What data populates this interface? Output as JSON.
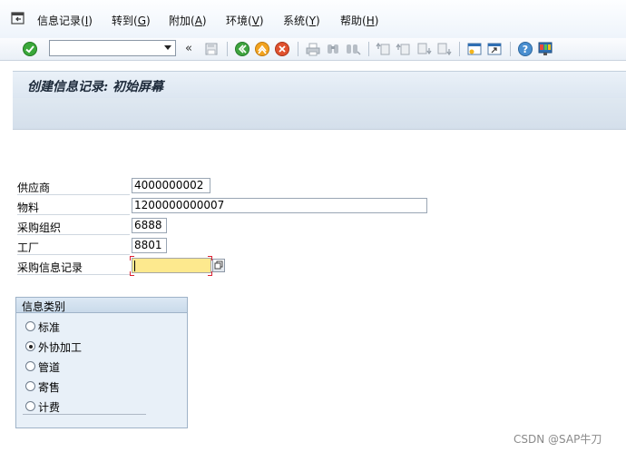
{
  "menu": {
    "items": [
      {
        "label": "信息记录(",
        "key": "I",
        "end": ")"
      },
      {
        "label": "转到(",
        "key": "G",
        "end": ")"
      },
      {
        "label": "附加(",
        "key": "A",
        "end": ")"
      },
      {
        "label": "环境(",
        "key": "V",
        "end": ")"
      },
      {
        "label": "系统(",
        "key": "Y",
        "end": ")"
      },
      {
        "label": "帮助(",
        "key": "H",
        "end": ")"
      }
    ]
  },
  "toolbar": {
    "command_value": "",
    "expand_glyph": "«"
  },
  "screen": {
    "title": "创建信息记录: 初始屏幕"
  },
  "form": {
    "vendor_label": "供应商",
    "vendor_value": "4000000002",
    "material_label": "物料",
    "material_value": "1200000000007",
    "purch_org_label": "采购组织",
    "purch_org_value": "6888",
    "plant_label": "工厂",
    "plant_value": "8801",
    "info_record_label": "采购信息记录",
    "info_record_value": ""
  },
  "info_category": {
    "title": "信息类别",
    "options": [
      {
        "label": "标准",
        "selected": false
      },
      {
        "label": "外协加工",
        "selected": true
      },
      {
        "label": "管道",
        "selected": false
      },
      {
        "label": "寄售",
        "selected": false
      },
      {
        "label": "计费",
        "selected": false
      }
    ]
  },
  "watermark": "CSDN @SAP牛刀",
  "colors": {
    "required_field": "#fde98e",
    "title_bg": "#dce6f1"
  }
}
